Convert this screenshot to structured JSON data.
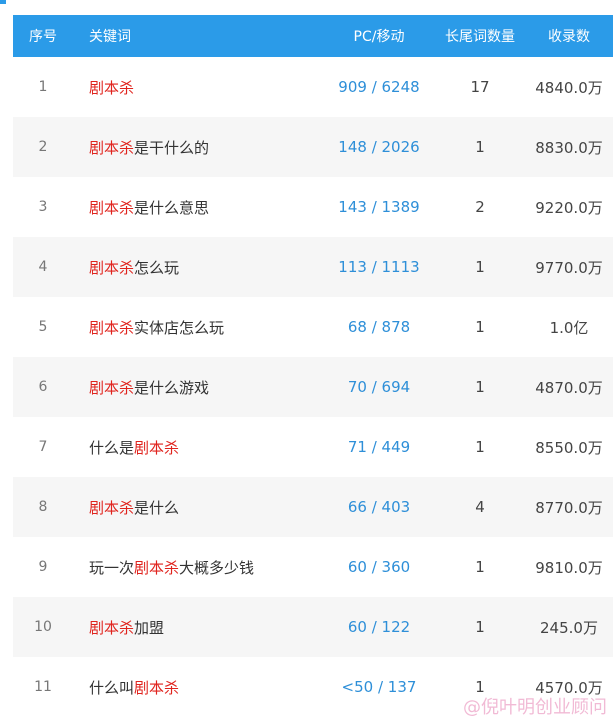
{
  "headers": {
    "index": "序号",
    "keyword": "关键词",
    "pc_mobile": "PC/移动",
    "longtail": "长尾词数量",
    "indexed": "收录数"
  },
  "rows": [
    {
      "index": "1",
      "pre": "",
      "key": "剧本杀",
      "post": "",
      "pc_mobile": "909 / 6248",
      "longtail": "17",
      "indexed": "4840.0万"
    },
    {
      "index": "2",
      "pre": "",
      "key": "剧本杀",
      "post": "是干什么的",
      "pc_mobile": "148 / 2026",
      "longtail": "1",
      "indexed": "8830.0万"
    },
    {
      "index": "3",
      "pre": "",
      "key": "剧本杀",
      "post": "是什么意思",
      "pc_mobile": "143 / 1389",
      "longtail": "2",
      "indexed": "9220.0万"
    },
    {
      "index": "4",
      "pre": "",
      "key": "剧本杀",
      "post": "怎么玩",
      "pc_mobile": "113 / 1113",
      "longtail": "1",
      "indexed": "9770.0万"
    },
    {
      "index": "5",
      "pre": "",
      "key": "剧本杀",
      "post": "实体店怎么玩",
      "pc_mobile": "68 / 878",
      "longtail": "1",
      "indexed": "1.0亿"
    },
    {
      "index": "6",
      "pre": "",
      "key": "剧本杀",
      "post": "是什么游戏",
      "pc_mobile": "70 / 694",
      "longtail": "1",
      "indexed": "4870.0万"
    },
    {
      "index": "7",
      "pre": "什么是",
      "key": "剧本杀",
      "post": "",
      "pc_mobile": "71 / 449",
      "longtail": "1",
      "indexed": "8550.0万"
    },
    {
      "index": "8",
      "pre": "",
      "key": "剧本杀",
      "post": "是什么",
      "pc_mobile": "66 / 403",
      "longtail": "4",
      "indexed": "8770.0万"
    },
    {
      "index": "9",
      "pre": "玩一次",
      "key": "剧本杀",
      "post": "大概多少钱",
      "pc_mobile": "60 / 360",
      "longtail": "1",
      "indexed": "9810.0万"
    },
    {
      "index": "10",
      "pre": "",
      "key": "剧本杀",
      "post": "加盟",
      "pc_mobile": "60 / 122",
      "longtail": "1",
      "indexed": "245.0万"
    },
    {
      "index": "11",
      "pre": "什么叫",
      "key": "剧本杀",
      "post": "",
      "pc_mobile": "<50 / 137",
      "longtail": "1",
      "indexed": "4570.0万"
    }
  ],
  "watermark": "@倪叶明创业顾问",
  "colors": {
    "header_bg": "#2b9be8",
    "keyword_highlight": "#e0231d",
    "pc_mobile_link": "#2e8fd8",
    "stripe": "#f6f6f6"
  }
}
